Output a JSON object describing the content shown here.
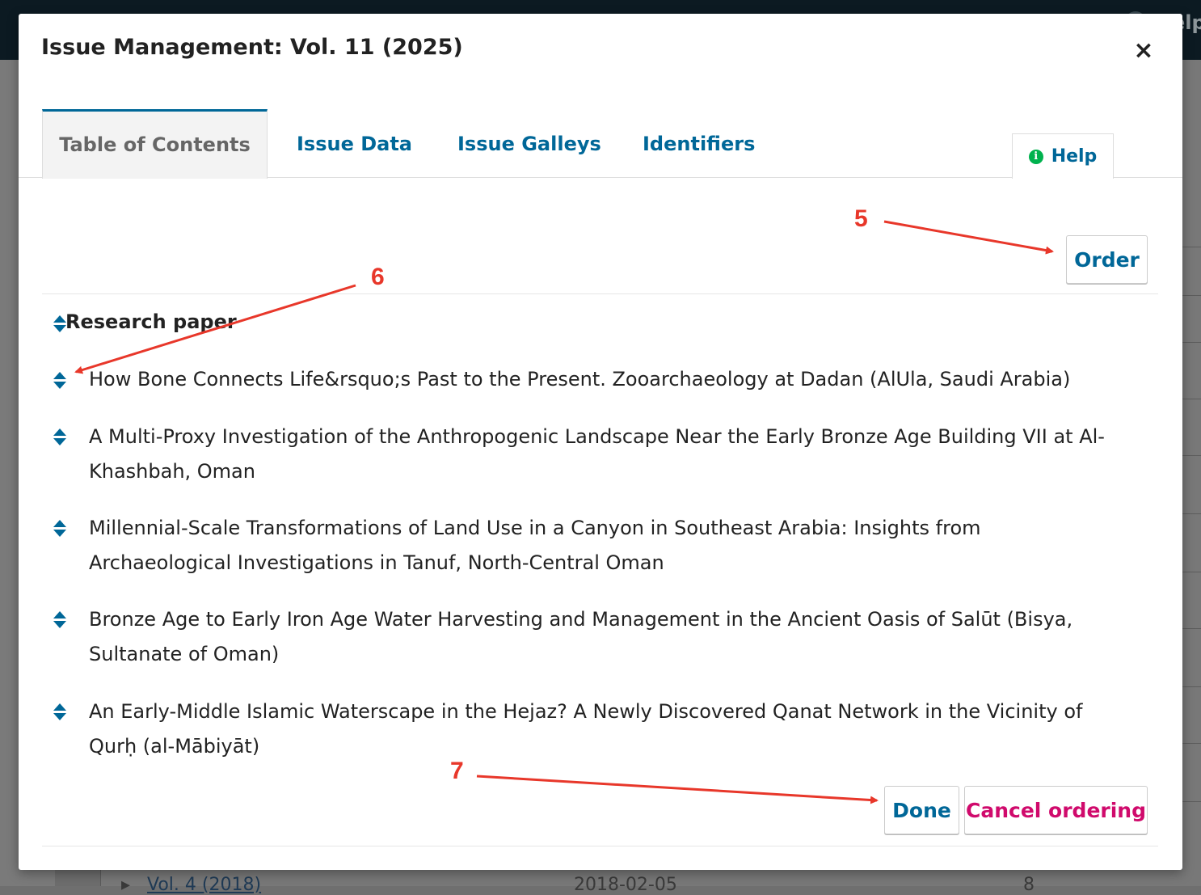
{
  "background": {
    "help_label": "elp",
    "row_title": "Vol. 4 (2018)",
    "row_date": "2018-02-05",
    "row_count": "8"
  },
  "modal": {
    "title": "Issue Management: Vol. 11 (2025)",
    "close_symbol": "×",
    "tabs": [
      {
        "label": "Table of Contents",
        "active": true
      },
      {
        "label": "Issue Data",
        "active": false
      },
      {
        "label": "Issue Galleys",
        "active": false
      },
      {
        "label": "Identifiers",
        "active": false
      }
    ],
    "help": {
      "label": "Help",
      "icon": "info-icon",
      "icon_glyph": "i"
    },
    "order_button": "Order",
    "section": {
      "title": "Research paper"
    },
    "articles": [
      "How Bone Connects Life&rsquo;s Past to the Present. Zooarchaeology at Dadan (AlUla, Saudi Arabia)",
      "A Multi-Proxy Investigation of the Anthropogenic Landscape Near the Early Bronze Age Building VII at Al-Khashbah, Oman",
      "Millennial-Scale Transformations of Land Use in a Canyon in Southeast Arabia: Insights from Archaeological Investigations in Tanuf, North-Central Oman",
      "Bronze Age to Early Iron Age Water Harvesting and Management in the Ancient Oasis of Salūt (Bisya, Sultanate of Oman)",
      "An Early-Middle Islamic Waterscape in the Hejaz? A Newly Discovered Qanat Network in the Vicinity of Qurḥ (al-Mābiyāt)"
    ],
    "done_button": "Done",
    "cancel_button": "Cancel ordering"
  },
  "annotations": {
    "five": "5",
    "six": "6",
    "seven": "7",
    "color": "#e8372a"
  },
  "colors": {
    "accent": "#006798",
    "cancel": "#d00a6c",
    "help_icon": "#00b24e"
  }
}
